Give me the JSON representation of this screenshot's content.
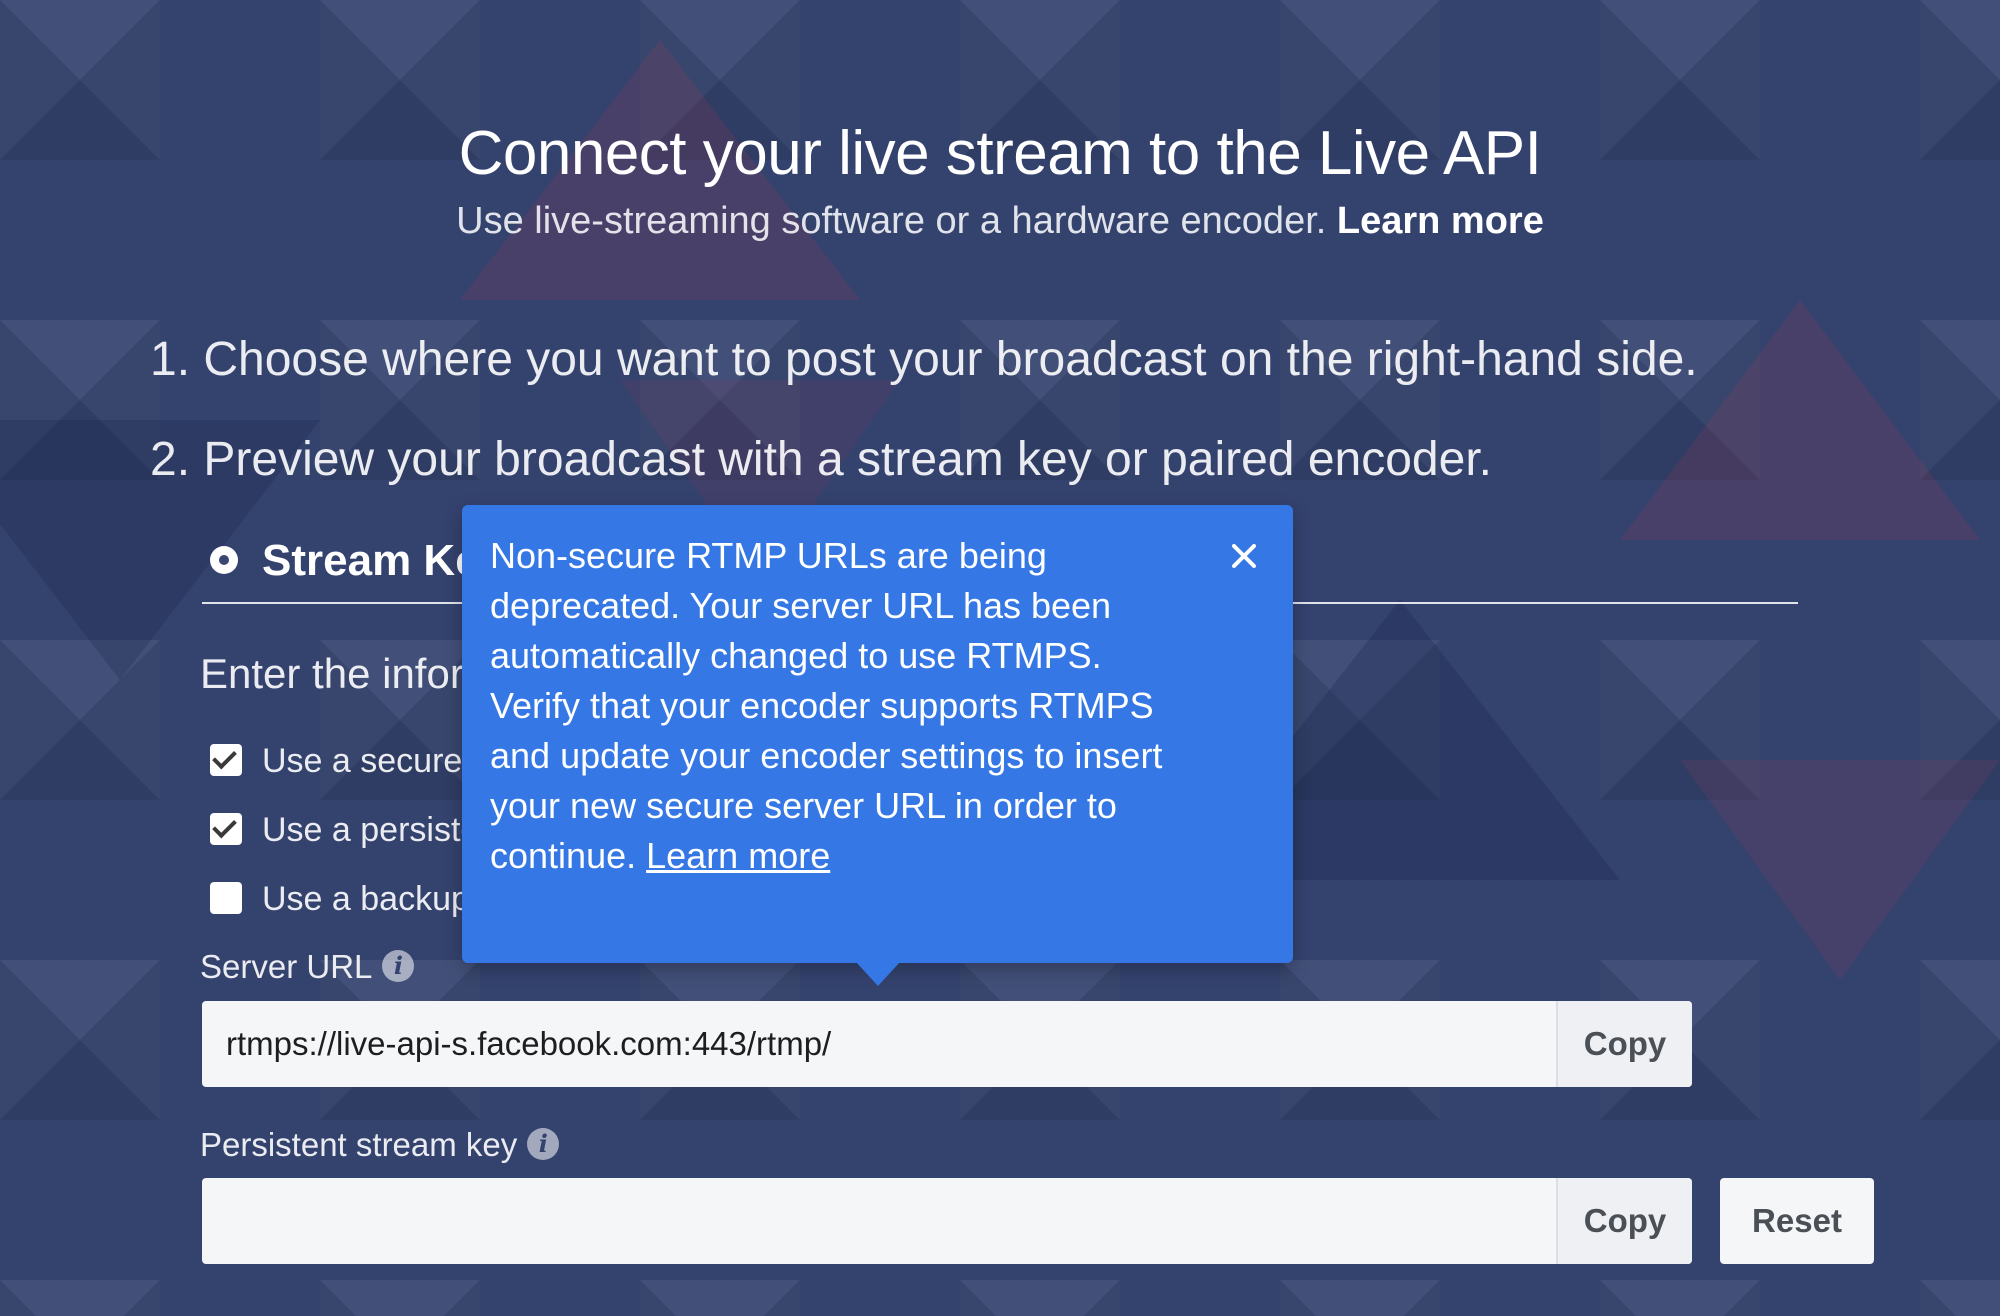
{
  "header": {
    "title": "Connect your live stream to the Live API",
    "subtitle": "Use live-streaming software or a hardware encoder.",
    "learn_more": "Learn more"
  },
  "steps": [
    "1. Choose where you want to post your broadcast on the right-hand side.",
    "2. Preview your broadcast with a stream key or paired encoder."
  ],
  "tab": {
    "label": "Stream Key",
    "selected": true
  },
  "instructions": "Enter the information below into your encoder settings.",
  "options": [
    {
      "label": "Use a secure connection (SSL)",
      "checked": true
    },
    {
      "label": "Use a persistent stream key",
      "checked": true
    },
    {
      "label": "Use a backup stream",
      "checked": false
    }
  ],
  "server_url": {
    "label": "Server URL",
    "value": "rtmps://live-api-s.facebook.com:443/rtmp/",
    "copy_label": "Copy"
  },
  "stream_key": {
    "label": "Persistent stream key",
    "value": "",
    "copy_label": "Copy",
    "reset_label": "Reset"
  },
  "tooltip": {
    "message": "Non-secure RTMP URLs are being deprecated. Your server URL has been automatically changed to use RTMPS. Verify that your encoder supports RTMPS and update your encoder settings to insert your new secure server URL in order to continue.",
    "link": "Learn more",
    "close_icon": "close-icon"
  },
  "colors": {
    "background": "#34426e",
    "tooltip": "#3578e5",
    "input_background": "#f5f6f7",
    "button_text": "#4b4f56"
  }
}
